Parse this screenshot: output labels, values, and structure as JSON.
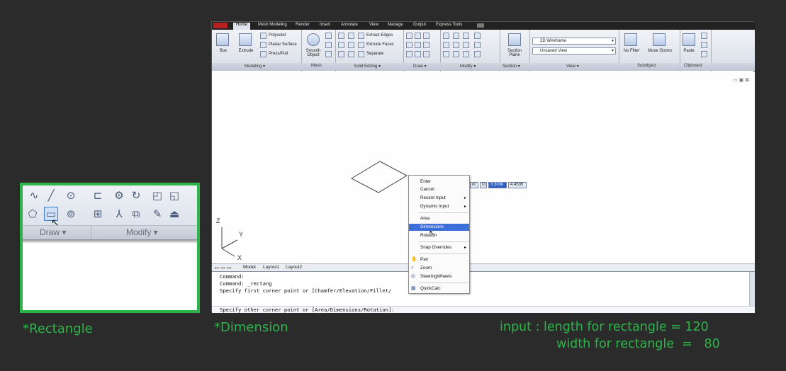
{
  "zoom_panel": {
    "draw_label": "Draw",
    "modify_label": "Modify"
  },
  "captions": {
    "left": "*Rectangle",
    "center": "*Dimension",
    "right_line1": "input : length for rectangle = 120",
    "right_line2": "width for rectangle  =   80"
  },
  "ribbon": {
    "tabs": [
      "Home",
      "Mesh Modeling",
      "Render",
      "Insert",
      "Annotate",
      "View",
      "Manage",
      "Output",
      "Express Tools"
    ],
    "buttons": {
      "box": "Box",
      "extrude": "Extrude",
      "polysolid": "Polysolid",
      "planar_surface": "Planar Surface",
      "press_pull": "Press/Pull",
      "smooth_object": "Smooth Object",
      "extract_edges": "Extract Edges",
      "extrude_faces": "Extrude Faces",
      "separate": "Separate",
      "section_plane": "Section Plane",
      "visual_style": "2D Wireframe",
      "view_select": "Unsaved View",
      "no_filter": "No Filter",
      "move_gizmo": "Move Gizmo",
      "paste": "Paste"
    },
    "panels": [
      "Modeling",
      "Mesh",
      "Solid Editing",
      "Draw",
      "Modify",
      "Section",
      "View",
      "Subobject",
      "Clipboard"
    ]
  },
  "layout_tabs": [
    "Model",
    "Layout1",
    "Layout2"
  ],
  "context_menu": {
    "items": [
      "Enter",
      "Cancel",
      "Recent Input",
      "Dynamic Input",
      "Area",
      "Dimensions",
      "Rotation",
      "Snap Overrides",
      "Pan",
      "Zoom",
      "SteeringWheels",
      "QuickCalc"
    ],
    "highlighted": "Dimensions"
  },
  "dynamic_input": {
    "prefix": "or",
    "value1": "3.3030",
    "value2": "4.4535"
  },
  "ucs": {
    "x": "X",
    "y": "Y",
    "z": "Z"
  },
  "command_lines": [
    "Command:",
    "Command: _rectang",
    "Specify first corner point or [Chamfer/Elevation/Fillet/",
    "Specify other corner point or [Area/Dimensions/Rotation]:"
  ]
}
